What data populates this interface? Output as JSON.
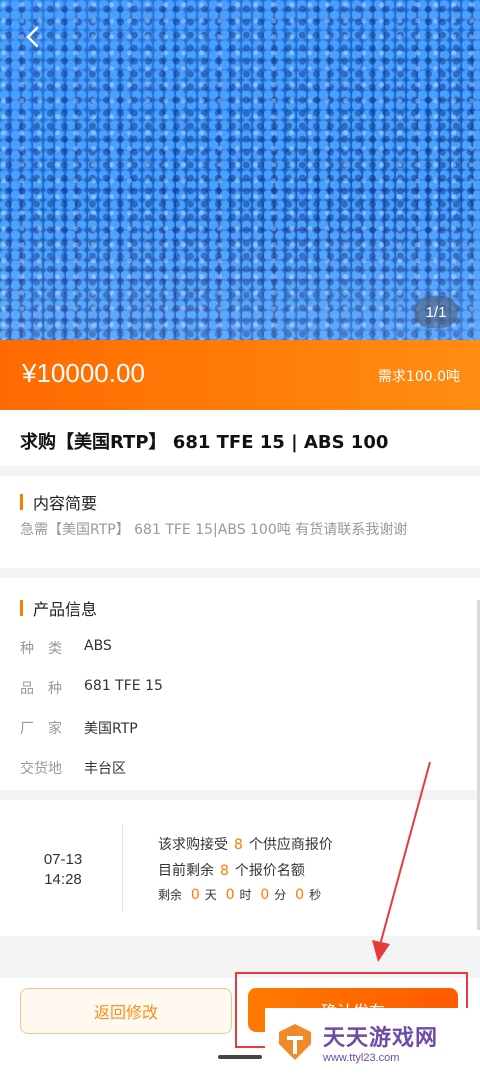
{
  "header": {
    "back_icon": "chevron-left-icon",
    "image_index": "1/1"
  },
  "price": {
    "amount": "¥10000.00",
    "demand": "需求100.0吨"
  },
  "product": {
    "title": "求购【美国RTP】 681 TFE 15 | ABS 100"
  },
  "summary": {
    "heading": "内容简要",
    "text": "急需【美国RTP】 681 TFE 15|ABS  100吨   有货请联系我谢谢"
  },
  "info": {
    "heading": "产品信息",
    "rows": [
      {
        "label": "种　类",
        "value": "ABS"
      },
      {
        "label": "品　种",
        "value": "681 TFE 15"
      },
      {
        "label": "厂　家",
        "value": "美国RTP"
      },
      {
        "label": "交货地",
        "value": "丰台区"
      }
    ]
  },
  "quota": {
    "date": "07-13",
    "time": "14:28",
    "line1_pre": "该求购接受",
    "line1_num": "8",
    "line1_post": "个供应商报价",
    "line2_pre": "目前剩余",
    "line2_num": "8",
    "line2_post": "个报价名额",
    "countdown": {
      "prefix": "剩余",
      "days": "0",
      "days_unit": "天",
      "hours": "0",
      "hours_unit": "时",
      "minutes": "0",
      "minutes_unit": "分",
      "seconds": "0",
      "seconds_unit": "秒"
    }
  },
  "actions": {
    "back_modify": "返回修改",
    "confirm": "确认发布"
  },
  "watermark": {
    "name": "天天游戏网",
    "url": "www.ttyl23.com"
  },
  "colors": {
    "accent": "#ff7a00",
    "annotation_red": "#e53b3b"
  }
}
